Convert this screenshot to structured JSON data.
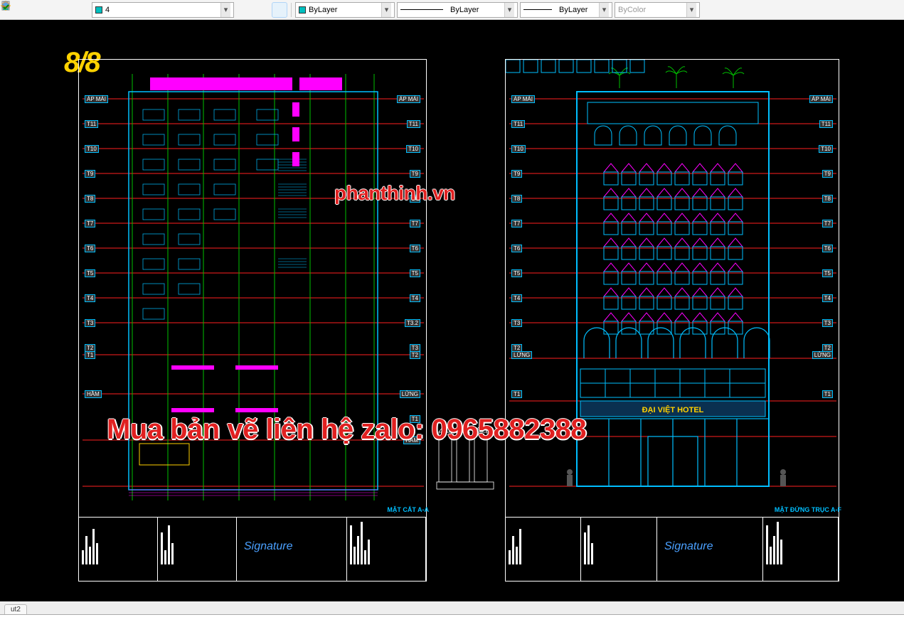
{
  "toolbar": {
    "layer_combo": "4",
    "linetype1": "ByLayer",
    "linetype2": "ByLayer",
    "linetype3": "ByLayer",
    "color": "ByColor"
  },
  "bottom_tab": "ut2",
  "watermarks": {
    "url": "phanthinh.vn",
    "contact": "Mua bản vẽ liên hệ zalo: 0965882388"
  },
  "page_number": "8/8",
  "drawing1": {
    "title": "MẶT CẮT A-A",
    "levels_left": [
      "ÁP MÁI",
      "T11",
      "T10",
      "T9",
      "T8",
      "T7",
      "T6",
      "T5",
      "T4",
      "T3",
      "T2",
      "T1",
      "HẦM"
    ],
    "levels_right": [
      "ÁP MÁI",
      "T11",
      "T10",
      "T9",
      "T8",
      "T7",
      "T6",
      "T5",
      "T4",
      "T3.2",
      "T3",
      "T2",
      "LỬNG",
      "T1",
      "HẦM"
    ]
  },
  "drawing2": {
    "title": "MẶT ĐỨNG TRỤC A-F",
    "sign_text": "ĐẠI VIỆT HOTEL",
    "levels_left": [
      "ÁP MÁI",
      "T11",
      "T10",
      "T9",
      "T8",
      "T7",
      "T6",
      "T5",
      "T4",
      "T3",
      "T2",
      "LỬNG",
      "T1"
    ],
    "levels_right": [
      "ÁP MÁI",
      "T11",
      "T10",
      "T9",
      "T8",
      "T7",
      "T6",
      "T5",
      "T4",
      "T3",
      "T2",
      "LỬNG",
      "T1"
    ]
  }
}
